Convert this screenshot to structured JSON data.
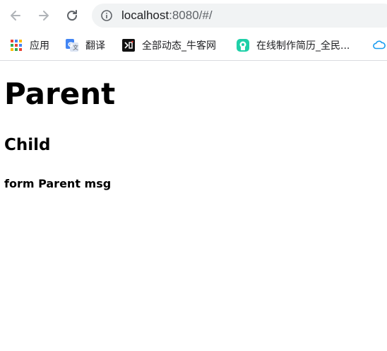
{
  "browser": {
    "nav": {
      "back_icon": "arrow-left-icon",
      "forward_icon": "arrow-right-icon",
      "reload_icon": "reload-icon"
    },
    "address_bar": {
      "info_icon": "info-circle-icon",
      "url_host": "localhost",
      "url_rest": ":8080/#/"
    },
    "bookmarks": [
      {
        "label": "应用",
        "icon": "apps-grid-icon"
      },
      {
        "label": "翻译",
        "icon": "google-translate-icon"
      },
      {
        "label": "全部动态_牛客网",
        "icon": "nowcoder-icon"
      },
      {
        "label": "在线制作简历_全民...",
        "icon": "resume-icon"
      },
      {
        "label": "",
        "icon": "cloud-icon"
      }
    ]
  },
  "page": {
    "parent_heading": "Parent",
    "child_heading": "Child",
    "message": "form Parent msg"
  }
}
